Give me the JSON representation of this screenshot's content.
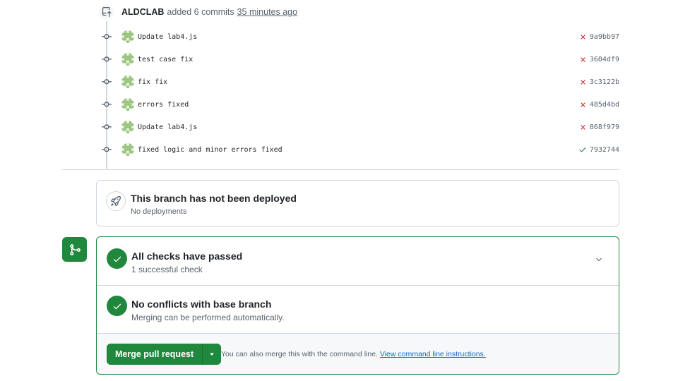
{
  "push_event": {
    "author": "ALDCLAB",
    "text": "added 6 commits",
    "time": "35 minutes ago"
  },
  "commits": [
    {
      "message": "Update lab4.js",
      "status": "failure",
      "sha": "9a9bb97"
    },
    {
      "message": "test case fix",
      "status": "failure",
      "sha": "3604df9"
    },
    {
      "message": "fix fix",
      "status": "failure",
      "sha": "3c3122b"
    },
    {
      "message": "errors fixed",
      "status": "failure",
      "sha": "485d4bd"
    },
    {
      "message": "Update lab4.js",
      "status": "failure",
      "sha": "868f979"
    },
    {
      "message": "fixed logic and minor errors fixed",
      "status": "success",
      "sha": "7932744"
    }
  ],
  "deployment": {
    "title": "This branch has not been deployed",
    "subtitle": "No deployments"
  },
  "merge_box": {
    "checks": {
      "title": "All checks have passed",
      "subtitle": "1 successful check"
    },
    "conflicts": {
      "title": "No conflicts with base branch",
      "subtitle": "Merging can be performed automatically."
    },
    "action": {
      "button_label": "Merge pull request",
      "cli_text": "You can also merge this with the command line.",
      "cli_link": "View command line instructions."
    }
  },
  "colors": {
    "success": "#1f883d",
    "failure": "#d1242f",
    "link": "#0969da",
    "muted": "#59636e",
    "border": "#d0d7de"
  },
  "icons": {
    "push": "repo-push-icon",
    "commit": "git-commit-icon",
    "failure": "x-icon",
    "success": "check-icon",
    "deploy": "rocket-icon",
    "merge": "git-merge-icon",
    "expand": "chevron-down-icon"
  }
}
